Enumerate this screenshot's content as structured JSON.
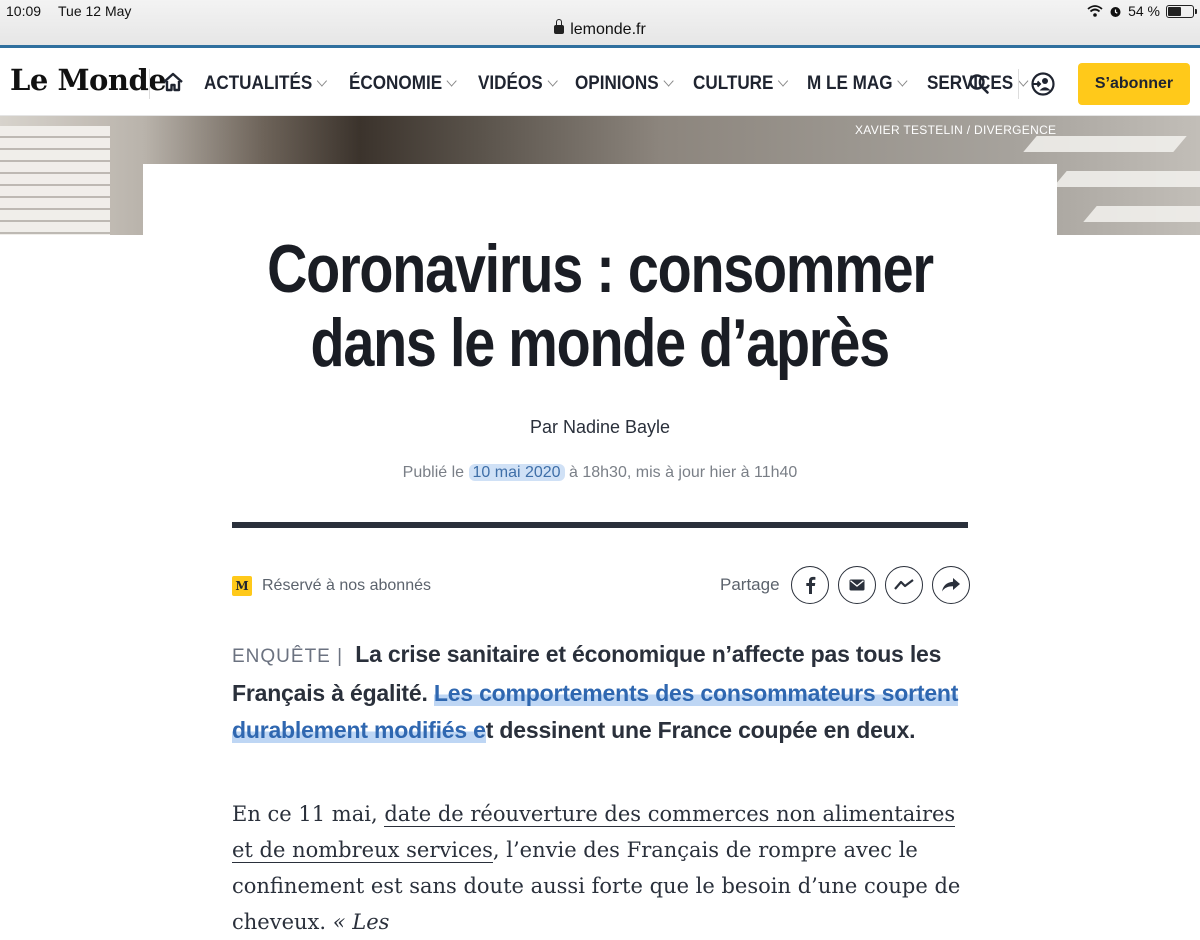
{
  "status_bar": {
    "time": "10:09",
    "date": "Tue 12 May",
    "battery": "54 %",
    "battery_level": 0.54,
    "url": "lemonde.fr"
  },
  "nav": {
    "logo": "Le Monde",
    "items": [
      {
        "label": "ACTUALITÉS"
      },
      {
        "label": "ÉCONOMIE"
      },
      {
        "label": "VIDÉOS"
      },
      {
        "label": "OPINIONS"
      },
      {
        "label": "CULTURE"
      },
      {
        "label": "M LE MAG"
      },
      {
        "label": "SERVICES"
      }
    ],
    "subscribe_label": "S’abonner"
  },
  "hero": {
    "credit": "XAVIER TESTELIN / DIVERGENCE"
  },
  "article": {
    "title_line1": "Coronavirus : consommer",
    "title_line2": "dans le monde d’après",
    "byline": "Par Nadine Bayle",
    "date_prefix": "Publié le",
    "date_highlight": "10 mai 2020",
    "date_suffix": "à 18h30, mis à jour hier à 11h40",
    "reserved_badge": "M",
    "reserved": "Réservé à nos abonnés",
    "share_label": "Partage",
    "kicker": "ENQUÊTE |",
    "lede_part1": "La crise sanitaire et économique n’affecte pas tous les Français à égalité.",
    "lede_highlight": "Les comportements des consommateurs sortent durablement modifiés e",
    "lede_part2": "t dessinent une France coupée en deux.",
    "body_start": "En ce 11 mai,",
    "body_link": "date de réouverture des commerces non alimentaires et de nombreux services",
    "body_rest": ", l’envie des Français de rompre avec le confinement est sans doute aussi forte que le besoin d’une coupe de cheveux.",
    "body_tail": "« Les"
  },
  "colors": {
    "accent": "#ffc91a",
    "highlight": "#6ea5e6",
    "text": "#2a303b"
  }
}
